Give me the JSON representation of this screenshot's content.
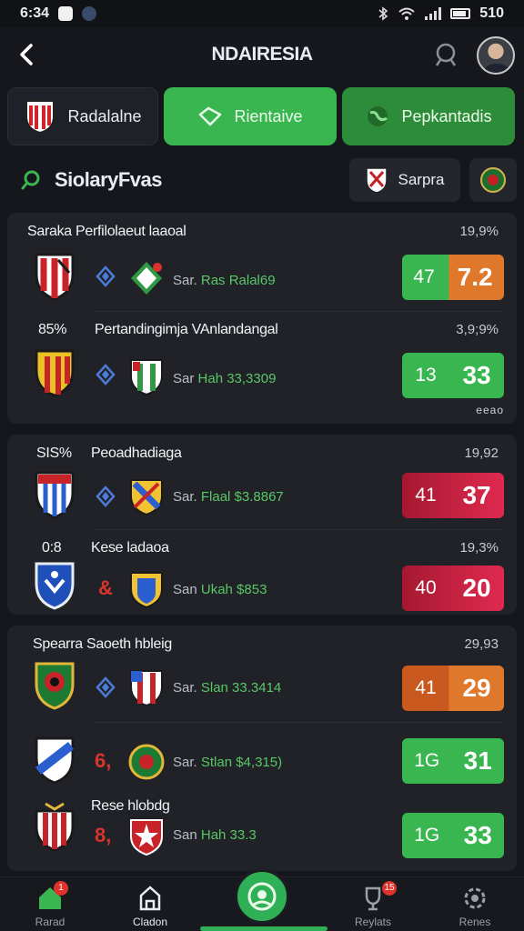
{
  "status": {
    "time": "6:34",
    "battery": "510"
  },
  "app": {
    "title": "NDAIRESIA"
  },
  "tabs": [
    {
      "label": "Radalalne"
    },
    {
      "label": "Rientaive"
    },
    {
      "label": "Pepkantadis"
    }
  ],
  "section": {
    "title": "SiolaryFvas",
    "chip_label": "Sarpra"
  },
  "cards": [
    {
      "matches": [
        {
          "label": "Saraka  Perfilolaeut laaoal",
          "pct": "19,9%",
          "info_prefix": "Sar.",
          "info_value": "Ras Ralal69",
          "score_a": "47",
          "score_b": "7.2"
        },
        {
          "label": "Pertandingimja VAnlandangal",
          "lead": "85%",
          "pct": "3,9;9%",
          "info_prefix": "Sar",
          "info_value": "Hah 33,3309",
          "score_a": "13",
          "score_b": "33"
        }
      ],
      "footer": "eeao"
    },
    {
      "matches": [
        {
          "label": "Peoadhadiaga",
          "lead": "SIS%",
          "pct": "19,92",
          "info_prefix": "Sar.",
          "info_value": "Flaal $3.8867",
          "score_a": "41",
          "score_b": "37"
        },
        {
          "label": "Kese ladaoa",
          "lead": "0:8",
          "pct": "19,3%",
          "info_prefix": "San",
          "info_value": "Ukah $853",
          "mid": "&",
          "score_a": "40",
          "score_b": "20"
        }
      ]
    },
    {
      "matches": [
        {
          "label": "Spearra Saoeth hbleig",
          "pct": "29,93",
          "info_prefix": "Sar.",
          "info_value": "Slan 33.3414",
          "score_a": "41",
          "score_b": "29"
        },
        {
          "label": "",
          "pct": "",
          "info_prefix": "Sar.",
          "info_value": "Stlan $4,315)",
          "mid": "6,",
          "score_a": "1G",
          "score_b": "31"
        },
        {
          "label": "Rese hlobdg",
          "pct": "",
          "info_prefix": "San",
          "info_value": "Hah 33.3",
          "mid": "8,",
          "score_a": "1G",
          "score_b": "33"
        }
      ]
    }
  ],
  "nav": [
    {
      "label": "Rarad",
      "badge": "1"
    },
    {
      "label": "Cladon"
    },
    {
      "label": ""
    },
    {
      "label": "Reylats",
      "badge": "15"
    },
    {
      "label": "Renes"
    }
  ],
  "colors": {
    "green": "#3ab651",
    "orange": "#e0782b",
    "red": "#d92845",
    "dark": "#202228"
  }
}
